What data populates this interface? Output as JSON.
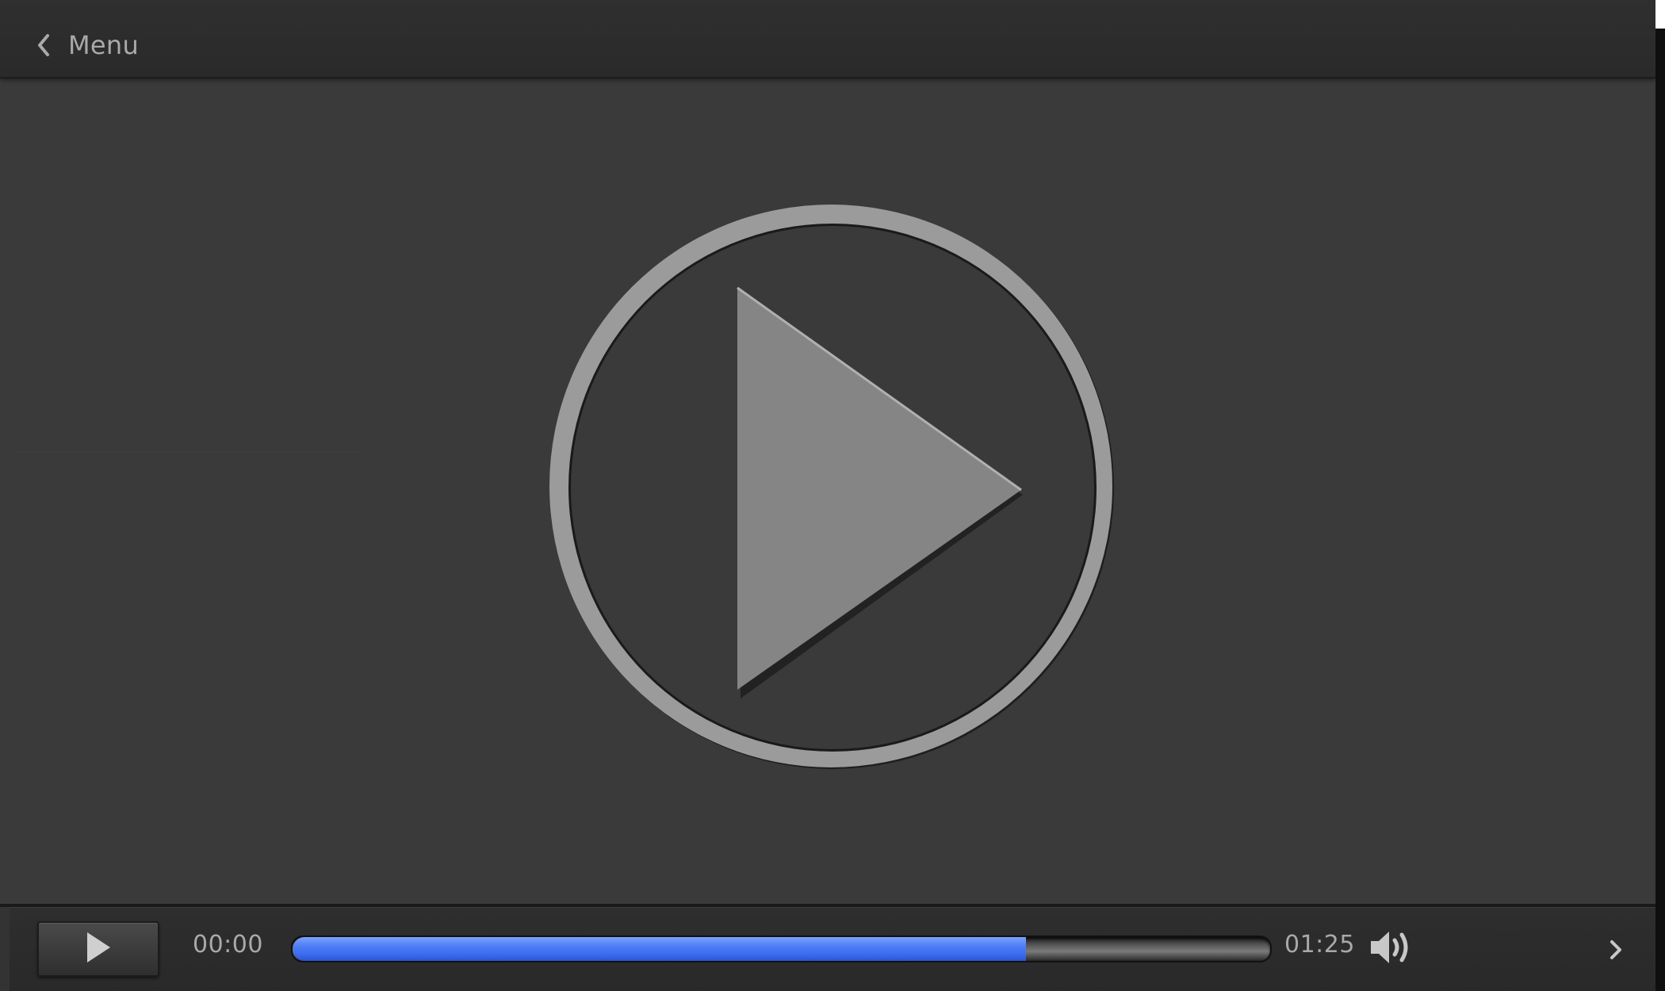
{
  "header": {
    "back_icon": "chevron-left-icon",
    "menu_label": "Menu"
  },
  "main": {
    "big_play_icon": "play-circle-icon"
  },
  "controls": {
    "play_icon": "play-icon",
    "current_time": "00:00",
    "total_time": "01:25",
    "progress_fraction": 0.75,
    "progress_color": "#4d7cf5",
    "volume_icon": "volume-icon",
    "next_icon": "chevron-right-icon"
  }
}
